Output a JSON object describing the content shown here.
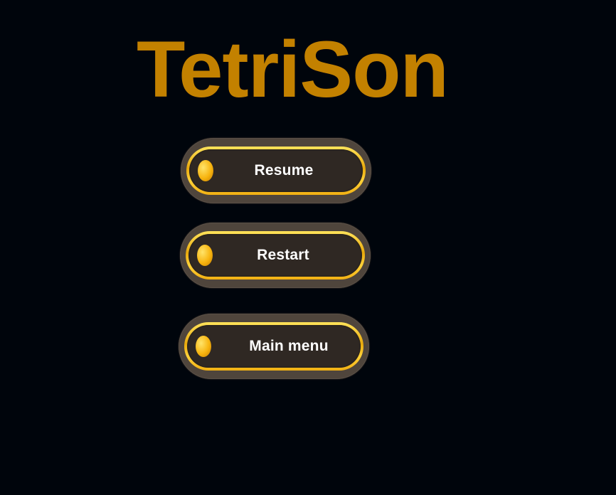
{
  "title": "TetriSon",
  "menu": {
    "resume_label": "Resume",
    "restart_label": "Restart",
    "main_menu_label": "Main menu"
  },
  "colors": {
    "background": "#00050c",
    "title": "#c38100",
    "button_frame": "#4f453c",
    "button_ring": "#f1b012",
    "button_face": "#2f2823",
    "label": "#ffffff"
  },
  "icons": {
    "button_marker": "gem-icon"
  }
}
